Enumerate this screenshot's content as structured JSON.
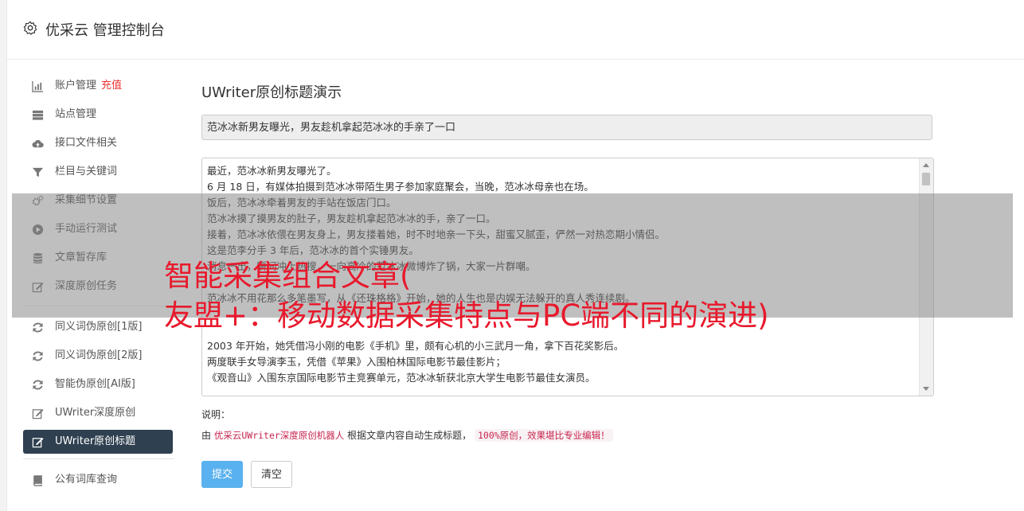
{
  "header": {
    "title": "优采云 管理控制台",
    "icon": "gear-icon"
  },
  "sidebar": {
    "group1": [
      {
        "label": "账户管理",
        "badge": "充值",
        "icon": "bar-chart-icon"
      },
      {
        "label": "站点管理",
        "icon": "server-icon"
      },
      {
        "label": "接口文件相关",
        "icon": "cloud-upload-icon"
      },
      {
        "label": "栏目与关键词",
        "icon": "filter-icon"
      },
      {
        "label": "采集细节设置",
        "icon": "cogs-icon"
      },
      {
        "label": "手动运行测试",
        "icon": "play-circle-icon"
      },
      {
        "label": "文章暂存库",
        "icon": "database-icon"
      },
      {
        "label": "深度原创任务",
        "icon": "edit-icon"
      }
    ],
    "group2": [
      {
        "label": "同义词伪原创[1版]",
        "icon": "refresh-icon"
      },
      {
        "label": "同义词伪原创[2版]",
        "icon": "refresh-icon"
      },
      {
        "label": "智能伪原创[AI版]",
        "icon": "refresh-icon"
      },
      {
        "label": "UWriter深度原创",
        "icon": "edit-icon"
      },
      {
        "label": "UWriter原创标题",
        "icon": "edit-icon",
        "active": true
      }
    ],
    "group3": [
      {
        "label": "公有词库查询",
        "icon": "book-icon"
      }
    ]
  },
  "main": {
    "title": "UWriter原创标题演示",
    "title_value": "范冰冰新男友曝光，男友趁机拿起范冰冰的手亲了一口",
    "content_lines": [
      "最近，范冰冰新男友曝光了。",
      "6 月 18 日，有媒体拍摄到范冰冰带陌生男子参加家庭聚会，当晚，范冰冰母亲也在场。",
      "饭后，范冰冰牵着男友的手站在饭店门口。",
      "范冰冰摸了摸男友的肚子，男友趁机拿起范冰冰的手，亲了一口。",
      "接着，范冰冰依偎在男友身上，男友搂着她，时不时地亲一下头，甜蜜又腻歪，俨然一对热恋期小情侣。",
      "这是范李分手 3 年后，范冰冰的首个实锤男友。",
      "消息一出，瞬间冲上热搜，一向高冷的范冰冰微博炸了锅，大家一片群嘲。",
      "",
      "范冰冰不用花那么多笔墨写，从《还珠格格》开始，她的人生也是内娱无法躲开的真人秀连续剧。",
      "",
      "",
      "2003 年开始，她凭借冯小刚的电影《手机》里，颇有心机的小三武月一角，拿下百花奖影后。",
      "两度联手女导演李玉，凭借《苹果》入围柏林国际电影节最佳影片；",
      "《观音山》入围东京国际电影节主竞赛单元，范冰冰斩获北京大学生电影节最佳女演员。"
    ],
    "note_label": "说明：",
    "note_prefix": "由",
    "note_link": "优采云UWriter深度原创机器人",
    "note_middle": "根据文章内容自动生成标题，",
    "note_code": "100%原创，效果堪比专业编辑！",
    "submit_label": "提交",
    "clear_label": "清空"
  },
  "watermark": {
    "line1": "智能采集组合文章(",
    "line2": "友盟+：移动数据采集特点与PC端不同的演进)"
  }
}
